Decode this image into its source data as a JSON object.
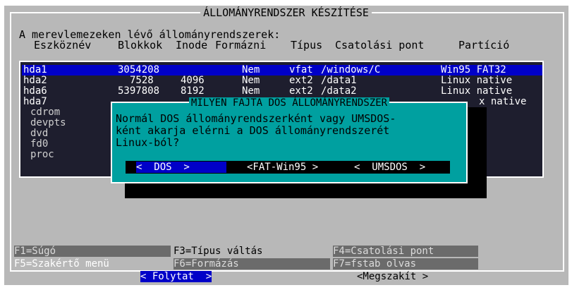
{
  "window": {
    "title": "ÁLLOMÁNYRENDSZER KÉSZÍTÉSE"
  },
  "section": {
    "heading": "A merevlemezeken lévő állományrendszerek:",
    "columns": [
      "Eszköznév",
      "Blokkok",
      "Inode",
      "Formázni",
      "Típus",
      "Csatolási pont",
      "Partíció"
    ]
  },
  "rows": [
    {
      "device": "hda1",
      "blocks": "3054208",
      "inode": "",
      "format": "Nem",
      "type": "vfat",
      "mount": "/windows/C",
      "partition": "Win95 FAT32"
    },
    {
      "device": "hda2",
      "blocks": "7528",
      "inode": "4096",
      "format": "Nem",
      "type": "ext2",
      "mount": "/data1",
      "partition": "Linux native"
    },
    {
      "device": "hda6",
      "blocks": "5397808",
      "inode": "8192",
      "format": "Nem",
      "type": "ext2",
      "mount": "/data2",
      "partition": "Linux native"
    },
    {
      "device": "hda7",
      "blocks": "",
      "inode": "",
      "format": "",
      "type": "",
      "mount": "",
      "partition": "x native"
    },
    {
      "device": "cdrom",
      "blocks": "",
      "inode": "",
      "format": "",
      "type": "",
      "mount": "",
      "partition": ""
    },
    {
      "device": "devpts",
      "blocks": "",
      "inode": "",
      "format": "",
      "type": "",
      "mount": "",
      "partition": ""
    },
    {
      "device": "dvd",
      "blocks": "",
      "inode": "",
      "format": "",
      "type": "",
      "mount": "",
      "partition": ""
    },
    {
      "device": "fd0",
      "blocks": "",
      "inode": "",
      "format": "",
      "type": "",
      "mount": "",
      "partition": ""
    },
    {
      "device": "proc",
      "blocks": "",
      "inode": "",
      "format": "",
      "type": "",
      "mount": "",
      "partition": ""
    }
  ],
  "dialog": {
    "title": "MILYEN FAJTA DOS ÁLLOMÁNYRENDSZER",
    "lines": [
      "Normál DOS állományrendszerként vagy UMSDOS-",
      "ként akarja elérni a DOS állományrendszerét",
      "Linux-ból?"
    ],
    "buttons": [
      "<  DOS  >",
      "<FAT-Win95 >",
      "<  UMSDOS  >"
    ]
  },
  "fkeys": {
    "f1": "F1=Súgó",
    "f3": "F3=Típus váltás",
    "f4": "F4=Csatolási pont",
    "f5": "F5=Szakértő menü",
    "f6": "F6=Formázás",
    "f7": "F7=fstab olvas"
  },
  "bottom": {
    "continue": "< Folytat  >",
    "cancel": "<Megszakít >"
  },
  "colors": {
    "background": "#b8b8b8",
    "list": "#1e1e2e",
    "selection": "#0000c8",
    "dialog": "#00a0a0"
  }
}
